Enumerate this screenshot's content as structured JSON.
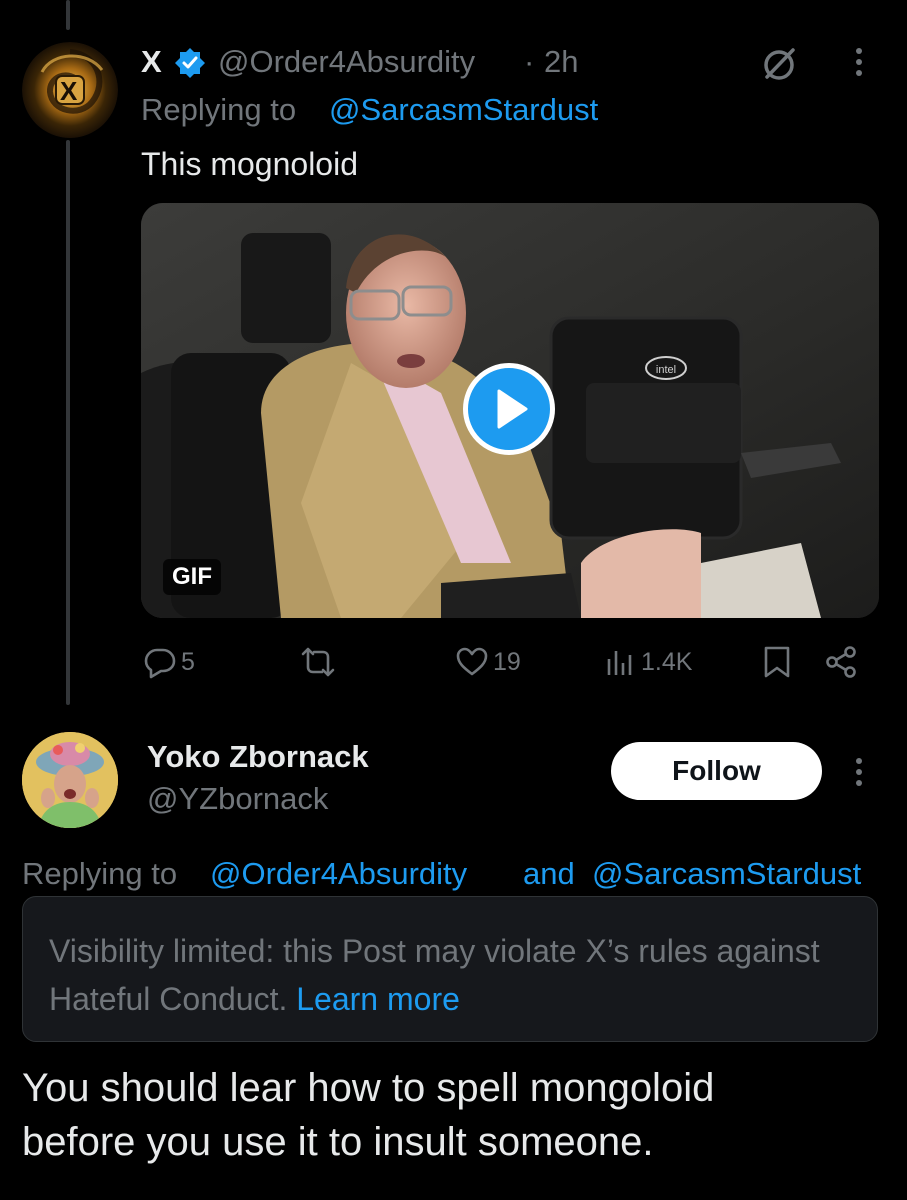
{
  "tweet1": {
    "display_name": "X",
    "handle": "@Order4Absurdity",
    "separator": "·",
    "time": "2h",
    "replying_prefix": "Replying to",
    "replying_to": "@SarcasmStardust",
    "body": "This mognoloid",
    "avatar_letter": "X",
    "media": {
      "badge": "GIF",
      "logo_text": "intel"
    },
    "actions": {
      "replies": "5",
      "reposts": "",
      "likes": "19",
      "views": "1.4K"
    }
  },
  "tweet2": {
    "display_name": "Yoko Zbornack",
    "handle": "@YZbornack",
    "follow_label": "Follow",
    "replying_prefix": "Replying to",
    "replying_to_1": "@Order4Absurdity",
    "replying_and": "and",
    "replying_to_2": "@SarcasmStardust",
    "notice_text": "Visibility limited: this Post may violate X’s rules against Hateful Conduct.",
    "notice_link": "Learn more",
    "body_line1": "You should lear how to spell mongoloid",
    "body_line2": "before you use it to insult someone."
  },
  "colors": {
    "background": "#000000",
    "text": "#e7e9ea",
    "secondary": "#71767b",
    "link": "#1d9bf0",
    "verified": "#1d9bf0"
  }
}
